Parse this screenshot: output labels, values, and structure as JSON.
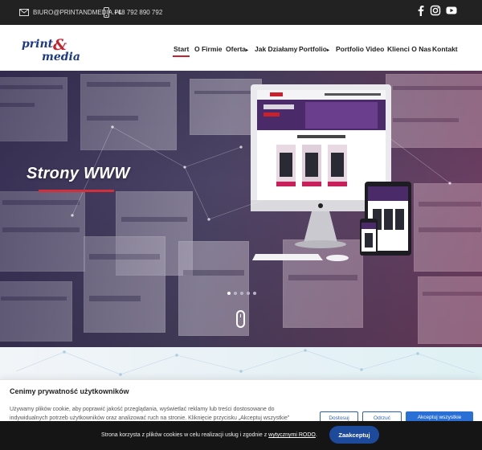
{
  "topbar": {
    "email": "BIURO@PRINTANDMEDIA.PL",
    "phone": "+48 792 890 792",
    "social": [
      "facebook-icon",
      "instagram-icon",
      "youtube-icon"
    ]
  },
  "brand": {
    "line1": "print",
    "line2": "media",
    "ampersand": "&",
    "colors": {
      "primary": "#1d3a8a",
      "accent": "#c8202c"
    }
  },
  "nav": {
    "items": [
      {
        "label": "Start",
        "active": true
      },
      {
        "label": "O Firmie"
      },
      {
        "label": "Oferta",
        "has_dropdown": true
      },
      {
        "label": "Jak Działamy"
      },
      {
        "label": "Portfolio",
        "has_dropdown": true
      },
      {
        "label": "Portfolio Video"
      },
      {
        "label": "Klienci O Nas"
      },
      {
        "label": "Kontakt"
      }
    ],
    "dropdown_glyph": "▸"
  },
  "hero": {
    "title": "Strony WWW",
    "slider_dots": 5,
    "active_dot": 1,
    "accent_color": "#d22f3a"
  },
  "cookie": {
    "title": "Cenimy prywatność użytkowników",
    "text": "Używamy plików cookie, aby poprawić jakość przeglądania, wyświetlać reklamy lub treści dostosowane do indywidualnych potrzeb użytkowników oraz analizować ruch na stronie. Kliknięcie przycisku „Akceptuj wszystkie”",
    "buttons": {
      "customize": "Dostosuj",
      "reject": "Odrzuć",
      "accept_all": "Akceptuj wszystkie"
    }
  },
  "bottombar": {
    "text_before": "Strona korzysta z plików cookies w celu realizacji usług i zgodnie z ",
    "link": "wytycznymi RODO",
    "text_after": ".",
    "accept": "Zaakceptuj"
  }
}
